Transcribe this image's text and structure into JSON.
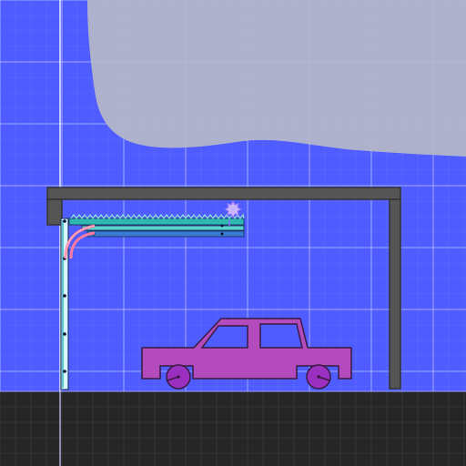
{
  "scene": {
    "type": "physics-sandbox",
    "colors": {
      "sky": "#4f5cff",
      "grid_minor": "#6a78ff",
      "grid_major": "#c8ccff",
      "fog": "#b6b8c8",
      "ground": "#262626",
      "ground_grid": "#3a3a3a",
      "beam": "#555555",
      "beam_stroke": "#333333",
      "car_body": "#b44bbd",
      "car_stroke": "#3a1a40",
      "wheel": "#9a2fc0",
      "track_teal": "#2fb8b0",
      "track_blue": "#3a7bd5",
      "spring_pink": "#ff7aa0",
      "gear": "#c9b6ff"
    },
    "objects": {
      "garage_frame": "gray-beam",
      "garage_door": "segmented-door-track",
      "door_opener": "gear-icon",
      "vehicle": "car-icon"
    }
  }
}
